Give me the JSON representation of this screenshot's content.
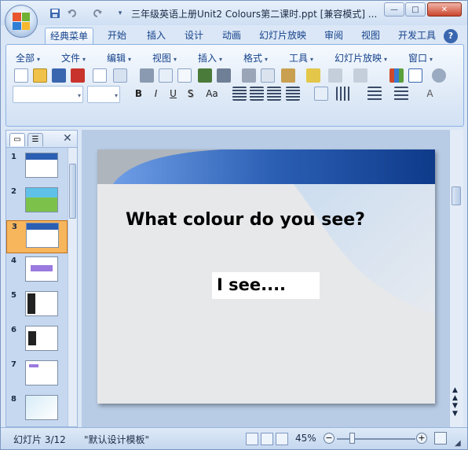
{
  "window": {
    "title": "三年级英语上册Unit2 Colours第二课时.ppt [兼容模式] ...",
    "controls": {
      "minimize": "—",
      "maximize": "□",
      "close": "✕"
    }
  },
  "tabs": [
    "经典菜单",
    "开始",
    "插入",
    "设计",
    "动画",
    "幻灯片放映",
    "审阅",
    "视图",
    "开发工具"
  ],
  "help_label": "?",
  "menus": [
    "全部",
    "文件",
    "编辑",
    "视图",
    "插入",
    "格式",
    "工具",
    "幻灯片放映",
    "窗口"
  ],
  "format_buttons": {
    "bold": "B",
    "italic": "I",
    "underline": "U",
    "shadow": "S",
    "case": "Aa",
    "fontcolor": "A"
  },
  "slides": [
    {
      "num": "1"
    },
    {
      "num": "2"
    },
    {
      "num": "3"
    },
    {
      "num": "4"
    },
    {
      "num": "5"
    },
    {
      "num": "6"
    },
    {
      "num": "7"
    },
    {
      "num": "8"
    }
  ],
  "selected_slide": 3,
  "slide": {
    "title": "What colour do you see?",
    "box_text": "I see...."
  },
  "status": {
    "slide_info": "幻灯片 3/12",
    "template": "\"默认设计模板\"",
    "zoom": "45%"
  },
  "colors": {
    "accent": "#15428b",
    "ribbon": "#dce8f6",
    "selected_thumb": "#f7b55c",
    "slide_header": "#2b5fb4"
  }
}
